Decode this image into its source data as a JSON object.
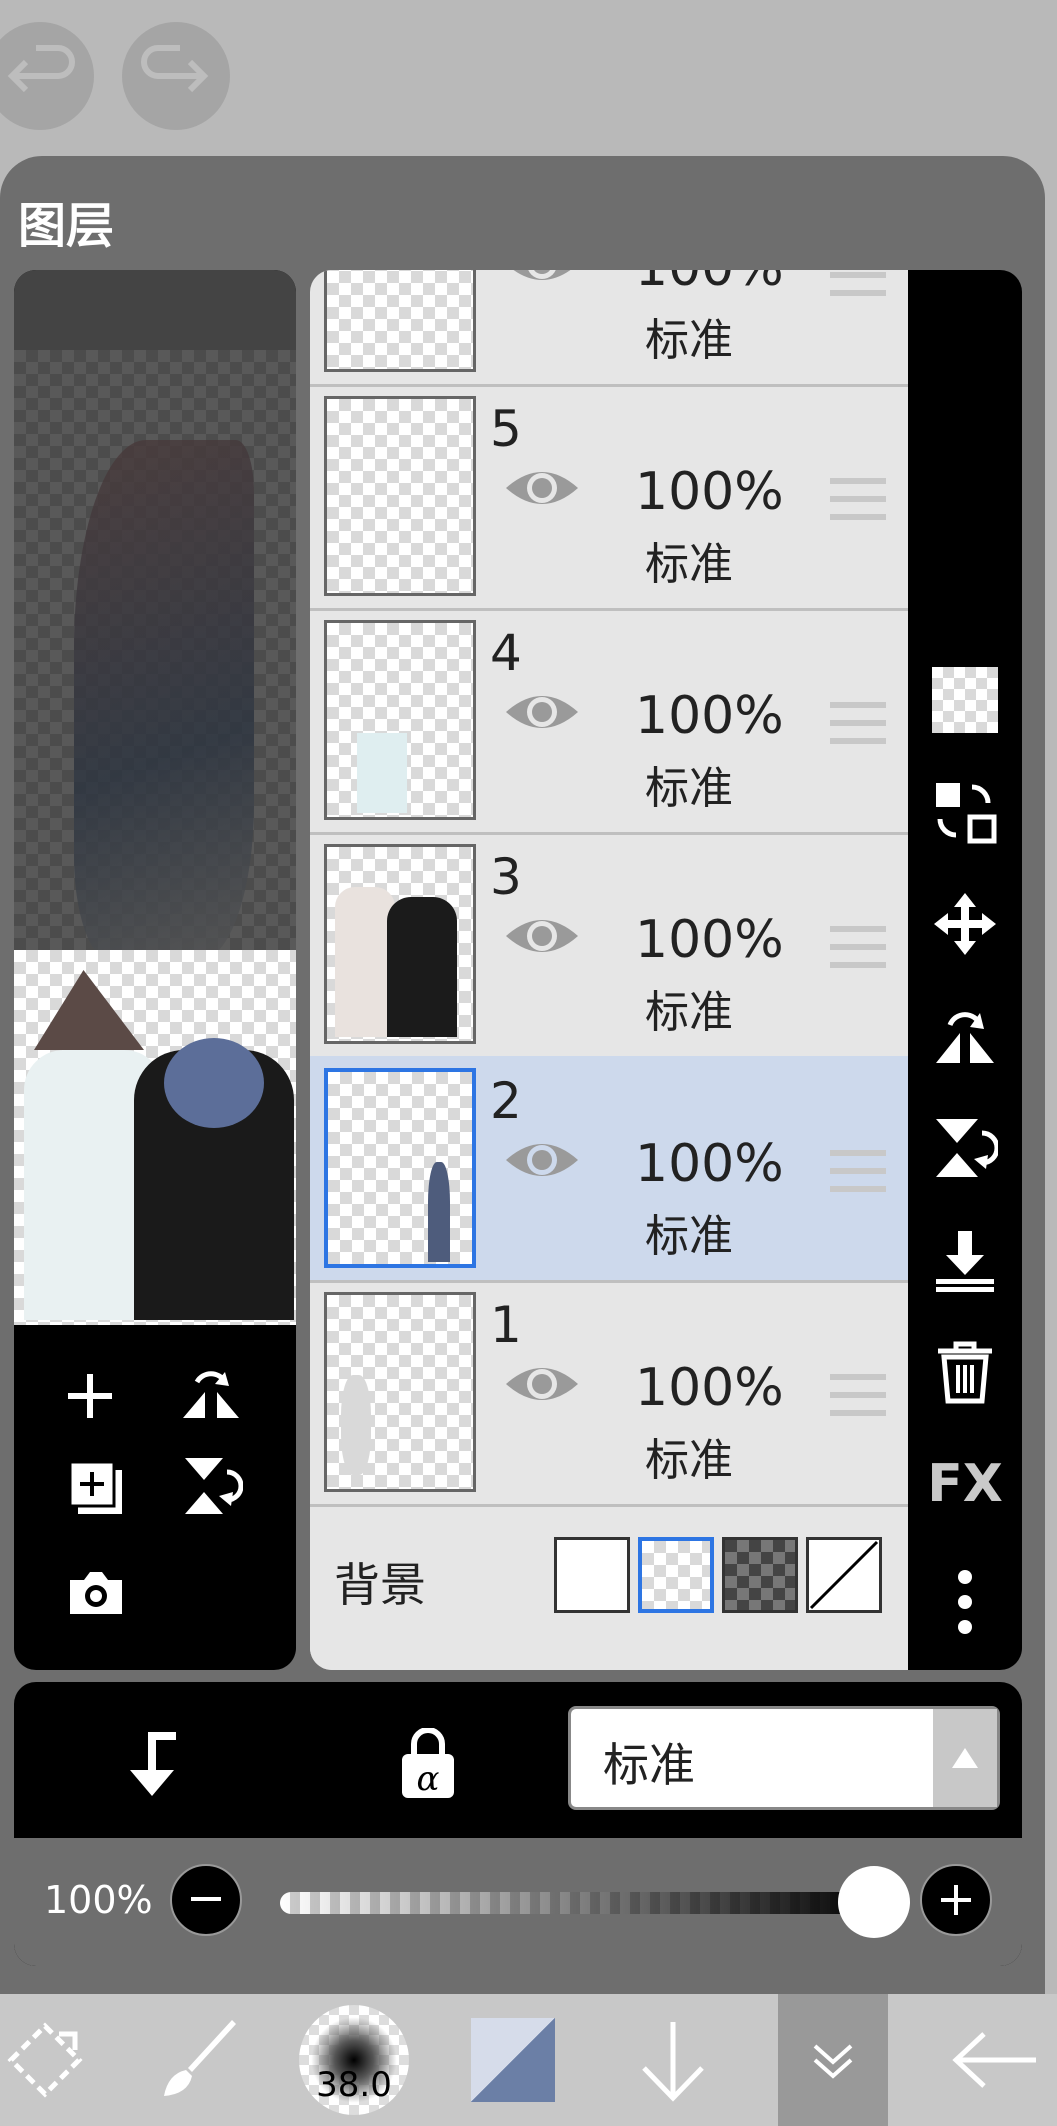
{
  "panel": {
    "title": "图层"
  },
  "layers": [
    {
      "name": "",
      "opacity": "100%",
      "mode": "标准",
      "selected": false
    },
    {
      "name": "5",
      "opacity": "100%",
      "mode": "标准",
      "selected": false
    },
    {
      "name": "4",
      "opacity": "100%",
      "mode": "标准",
      "selected": false
    },
    {
      "name": "3",
      "opacity": "100%",
      "mode": "标准",
      "selected": false
    },
    {
      "name": "2",
      "opacity": "100%",
      "mode": "标准",
      "selected": true
    },
    {
      "name": "1",
      "opacity": "100%",
      "mode": "标准",
      "selected": false
    }
  ],
  "background": {
    "label": "背景",
    "selected_swatch": "checker-light"
  },
  "blend": {
    "mode_label": "标准"
  },
  "opacity": {
    "label": "100%",
    "value": 1.0
  },
  "toolbar": {
    "brush_size": "38.0"
  },
  "right_icons": [
    "checker-icon",
    "layer-swap-icon",
    "move-icon",
    "flip-horizontal-icon",
    "flip-vertical-icon",
    "merge-down-icon",
    "trash-icon",
    "fx-icon",
    "more-icon"
  ],
  "colors": {
    "accent": "#2d75e3",
    "selected_row": "#cdd9ec",
    "panel_bg": "#6e6e6e"
  }
}
